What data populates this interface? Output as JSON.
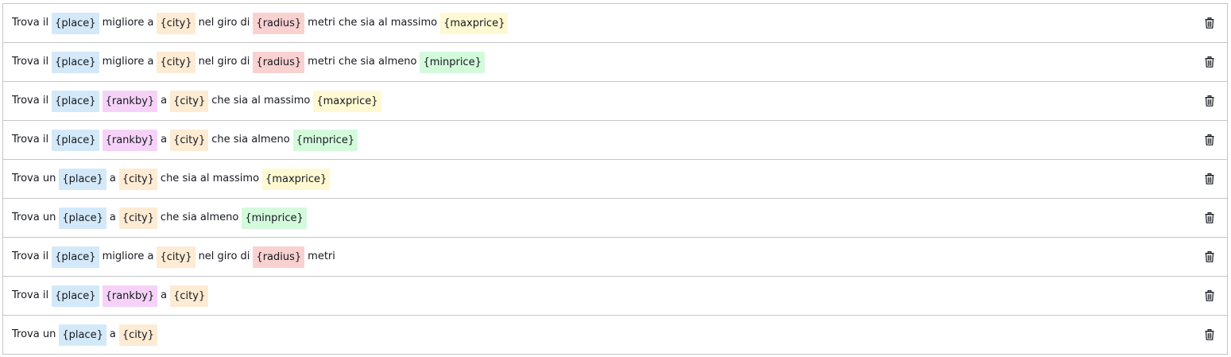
{
  "colors": {
    "place": "#d3e9f9",
    "city": "#fdebd3",
    "radius": "#f9d1d1",
    "maxprice": "#fef9d3",
    "minprice": "#d4fadc",
    "rankby": "#f6d2f8"
  },
  "delete_icon": "trash-icon",
  "utterances": [
    [
      {
        "t": "Trova il"
      },
      {
        "s": "place",
        "t": "{place}"
      },
      {
        "t": "migliore a"
      },
      {
        "s": "city",
        "t": "{city}"
      },
      {
        "t": "nel giro di"
      },
      {
        "s": "radius",
        "t": "{radius}"
      },
      {
        "t": "metri che sia al massimo"
      },
      {
        "s": "maxprice",
        "t": "{maxprice}"
      }
    ],
    [
      {
        "t": "Trova il"
      },
      {
        "s": "place",
        "t": "{place}"
      },
      {
        "t": "migliore a"
      },
      {
        "s": "city",
        "t": "{city}"
      },
      {
        "t": "nel giro di"
      },
      {
        "s": "radius",
        "t": "{radius}"
      },
      {
        "t": "metri che sia almeno"
      },
      {
        "s": "minprice",
        "t": "{minprice}"
      }
    ],
    [
      {
        "t": "Trova il"
      },
      {
        "s": "place",
        "t": "{place}"
      },
      {
        "s": "rankby",
        "t": "{rankby}"
      },
      {
        "t": "a"
      },
      {
        "s": "city",
        "t": "{city}"
      },
      {
        "t": "che sia al massimo"
      },
      {
        "s": "maxprice",
        "t": "{maxprice}"
      }
    ],
    [
      {
        "t": "Trova il"
      },
      {
        "s": "place",
        "t": "{place}"
      },
      {
        "s": "rankby",
        "t": "{rankby}"
      },
      {
        "t": "a"
      },
      {
        "s": "city",
        "t": "{city}"
      },
      {
        "t": "che sia almeno"
      },
      {
        "s": "minprice",
        "t": "{minprice}"
      }
    ],
    [
      {
        "t": "Trova un"
      },
      {
        "s": "place",
        "t": "{place}"
      },
      {
        "t": "a"
      },
      {
        "s": "city",
        "t": "{city}"
      },
      {
        "t": "che sia al massimo"
      },
      {
        "s": "maxprice",
        "t": "{maxprice}"
      }
    ],
    [
      {
        "t": "Trova un"
      },
      {
        "s": "place",
        "t": "{place}"
      },
      {
        "t": "a"
      },
      {
        "s": "city",
        "t": "{city}"
      },
      {
        "t": "che sia almeno"
      },
      {
        "s": "minprice",
        "t": "{minprice}"
      }
    ],
    [
      {
        "t": "Trova il"
      },
      {
        "s": "place",
        "t": "{place}"
      },
      {
        "t": "migliore a"
      },
      {
        "s": "city",
        "t": "{city}"
      },
      {
        "t": "nel giro di"
      },
      {
        "s": "radius",
        "t": "{radius}"
      },
      {
        "t": "metri"
      }
    ],
    [
      {
        "t": "Trova il"
      },
      {
        "s": "place",
        "t": "{place}"
      },
      {
        "s": "rankby",
        "t": "{rankby}"
      },
      {
        "t": "a"
      },
      {
        "s": "city",
        "t": "{city}"
      }
    ],
    [
      {
        "t": "Trova un"
      },
      {
        "s": "place",
        "t": "{place}"
      },
      {
        "t": "a"
      },
      {
        "s": "city",
        "t": "{city}"
      }
    ]
  ]
}
